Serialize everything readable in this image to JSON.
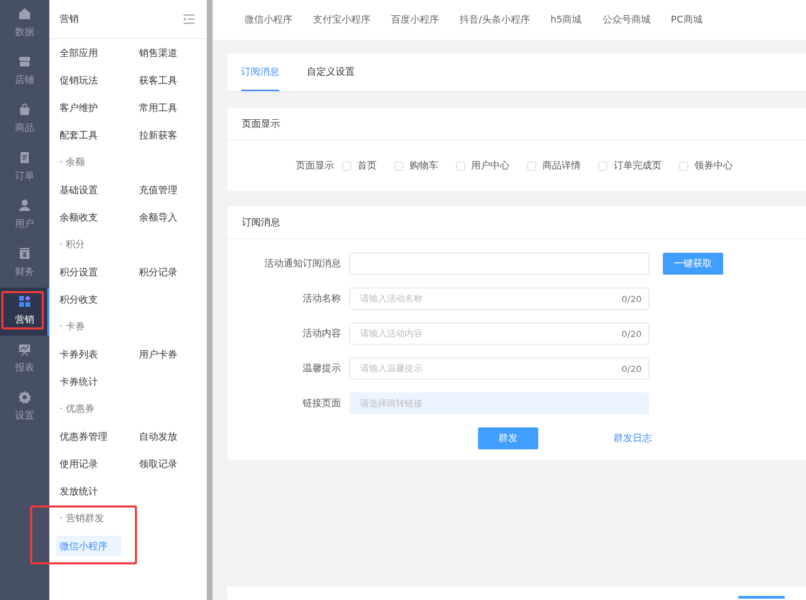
{
  "rail": {
    "items": [
      {
        "label": "数据",
        "selected": false,
        "highlighted": false
      },
      {
        "label": "店铺",
        "selected": false,
        "highlighted": false
      },
      {
        "label": "商品",
        "selected": false,
        "highlighted": false
      },
      {
        "label": "订单",
        "selected": false,
        "highlighted": false
      },
      {
        "label": "用户",
        "selected": false,
        "highlighted": false
      },
      {
        "label": "财务",
        "selected": false,
        "highlighted": false
      },
      {
        "label": "营销",
        "selected": true,
        "highlighted": true
      },
      {
        "label": "报表",
        "selected": false,
        "highlighted": false
      },
      {
        "label": "设置",
        "selected": false,
        "highlighted": false
      }
    ]
  },
  "menu": {
    "title": "营销",
    "sections": [
      {
        "highlighted": false,
        "items": [
          {
            "label": "全部应用",
            "selected": false
          },
          {
            "label": "销售渠道",
            "selected": false
          },
          {
            "label": "促销玩法",
            "selected": false
          },
          {
            "label": "获客工具",
            "selected": false
          },
          {
            "label": "客户维护",
            "selected": false
          },
          {
            "label": "常用工具",
            "selected": false
          },
          {
            "label": "配套工具",
            "selected": false
          },
          {
            "label": "拉新获客",
            "selected": false
          }
        ]
      },
      {
        "title": "· 余额",
        "highlighted": false,
        "items": [
          {
            "label": "基础设置",
            "selected": false
          },
          {
            "label": "充值管理",
            "selected": false
          },
          {
            "label": "余额收支",
            "selected": false
          },
          {
            "label": "余额导入",
            "selected": false
          }
        ]
      },
      {
        "title": "· 积分",
        "highlighted": false,
        "items": [
          {
            "label": "积分设置",
            "selected": false
          },
          {
            "label": "积分记录",
            "selected": false
          },
          {
            "label": "积分收支",
            "selected": false
          }
        ]
      },
      {
        "title": "· 卡券",
        "highlighted": false,
        "items": [
          {
            "label": "卡券列表",
            "selected": false
          },
          {
            "label": "用户卡券",
            "selected": false
          },
          {
            "label": "卡券统计",
            "selected": false
          }
        ]
      },
      {
        "title": "· 优惠券",
        "highlighted": false,
        "items": [
          {
            "label": "优惠券管理",
            "selected": false
          },
          {
            "label": "自动发放",
            "selected": false
          },
          {
            "label": "使用记录",
            "selected": false
          },
          {
            "label": "领取记录",
            "selected": false
          },
          {
            "label": "发放统计",
            "selected": false
          }
        ]
      },
      {
        "title": "· 营销群发",
        "highlighted": true,
        "items": [
          {
            "label": "微信小程序",
            "selected": true
          }
        ]
      }
    ]
  },
  "channel_tabs": [
    {
      "label": "微信小程序"
    },
    {
      "label": "支付宝小程序"
    },
    {
      "label": "百度小程序"
    },
    {
      "label": "抖音/头条小程序"
    },
    {
      "label": "h5商城"
    },
    {
      "label": "公众号商城"
    },
    {
      "label": "PC商城"
    }
  ],
  "tabs": [
    {
      "label": "订阅消息",
      "selected": true
    },
    {
      "label": "自定义设置",
      "selected": false
    }
  ],
  "page_display": {
    "title": "页面显示",
    "label": "页面显示",
    "options": [
      {
        "label": "首页",
        "checked": false
      },
      {
        "label": "购物车",
        "checked": false
      },
      {
        "label": "用户中心",
        "checked": false
      },
      {
        "label": "商品详情",
        "checked": false
      },
      {
        "label": "订单完成页",
        "checked": false
      },
      {
        "label": "领券中心",
        "checked": false
      }
    ]
  },
  "subscription": {
    "title": "订阅消息",
    "fields": [
      {
        "kind": "template",
        "label": "活动通知订阅消息",
        "button": "一键获取"
      },
      {
        "kind": "text",
        "label": "活动名称",
        "placeholder": "请输入活动名称",
        "count": "0/20"
      },
      {
        "kind": "text",
        "label": "活动内容",
        "placeholder": "请输入活动内容",
        "count": "0/20"
      },
      {
        "kind": "text",
        "label": "温馨提示",
        "placeholder": "请输入温馨提示",
        "count": "0/20"
      },
      {
        "kind": "select",
        "label": "链接页面",
        "placeholder": "请选择跳转链接"
      }
    ],
    "send_button": "群发",
    "log_link": "群发日志"
  }
}
